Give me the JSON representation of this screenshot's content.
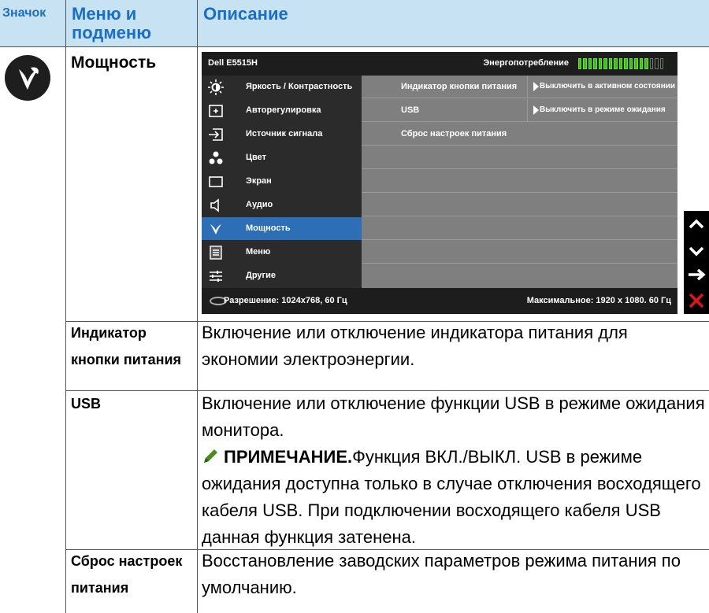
{
  "header": {
    "col1": "Значок",
    "col2": "Меню и подменю",
    "col3": "Описание"
  },
  "section": {
    "title": "Мощность",
    "icon": "leaf-icon"
  },
  "osd": {
    "model": "Dell E5515H",
    "energy_label": "Энергопотребление",
    "energy_level": 0.82,
    "menu": [
      {
        "label": "Яркость / Контрастность",
        "icon": "brightness-icon"
      },
      {
        "label": "Авторегулировка",
        "icon": "auto-adjust-icon"
      },
      {
        "label": "Источник сигнала",
        "icon": "input-source-icon"
      },
      {
        "label": "Цвет",
        "icon": "color-icon"
      },
      {
        "label": "Экран",
        "icon": "display-icon"
      },
      {
        "label": "Аудио",
        "icon": "audio-icon"
      },
      {
        "label": "Мощность",
        "icon": "leaf-icon",
        "active": true
      },
      {
        "label": "Меню",
        "icon": "menu-icon"
      },
      {
        "label": "Другие",
        "icon": "others-icon"
      }
    ],
    "submenu": [
      {
        "label": "Индикатор кнопки питания",
        "value": "Выключить в активном состоянии"
      },
      {
        "label": "USB",
        "value": "Выключить в режиме ожидания"
      },
      {
        "label": "Сброс настроек питания",
        "value": ""
      }
    ],
    "resolution": "Разрешение: 1024x768, 60 Гц",
    "max_resolution": "Максимальное: 1920 x 1080. 60 Гц"
  },
  "side_buttons": [
    "up-icon",
    "down-icon",
    "enter-icon",
    "exit-icon"
  ],
  "rows": [
    {
      "name": "Индикатор кнопки питания",
      "desc": "Включение или отключение индикатора питания для экономии электроэнергии."
    },
    {
      "name": "USB",
      "desc": "Включение или отключение функции USB в режиме ожидания монитора.",
      "note_label": "ПРИМЕЧАНИЕ.",
      "note_text": "Функция ВКЛ./ВЫКЛ. USB в режиме ожидания доступна только в случае отключения восходящего кабеля USB. При подключении восходящего кабеля USB данная функция затенена."
    },
    {
      "name": "Сброс настроек питания",
      "desc": "Восстановление заводских параметров режима питания по умолчанию."
    }
  ]
}
